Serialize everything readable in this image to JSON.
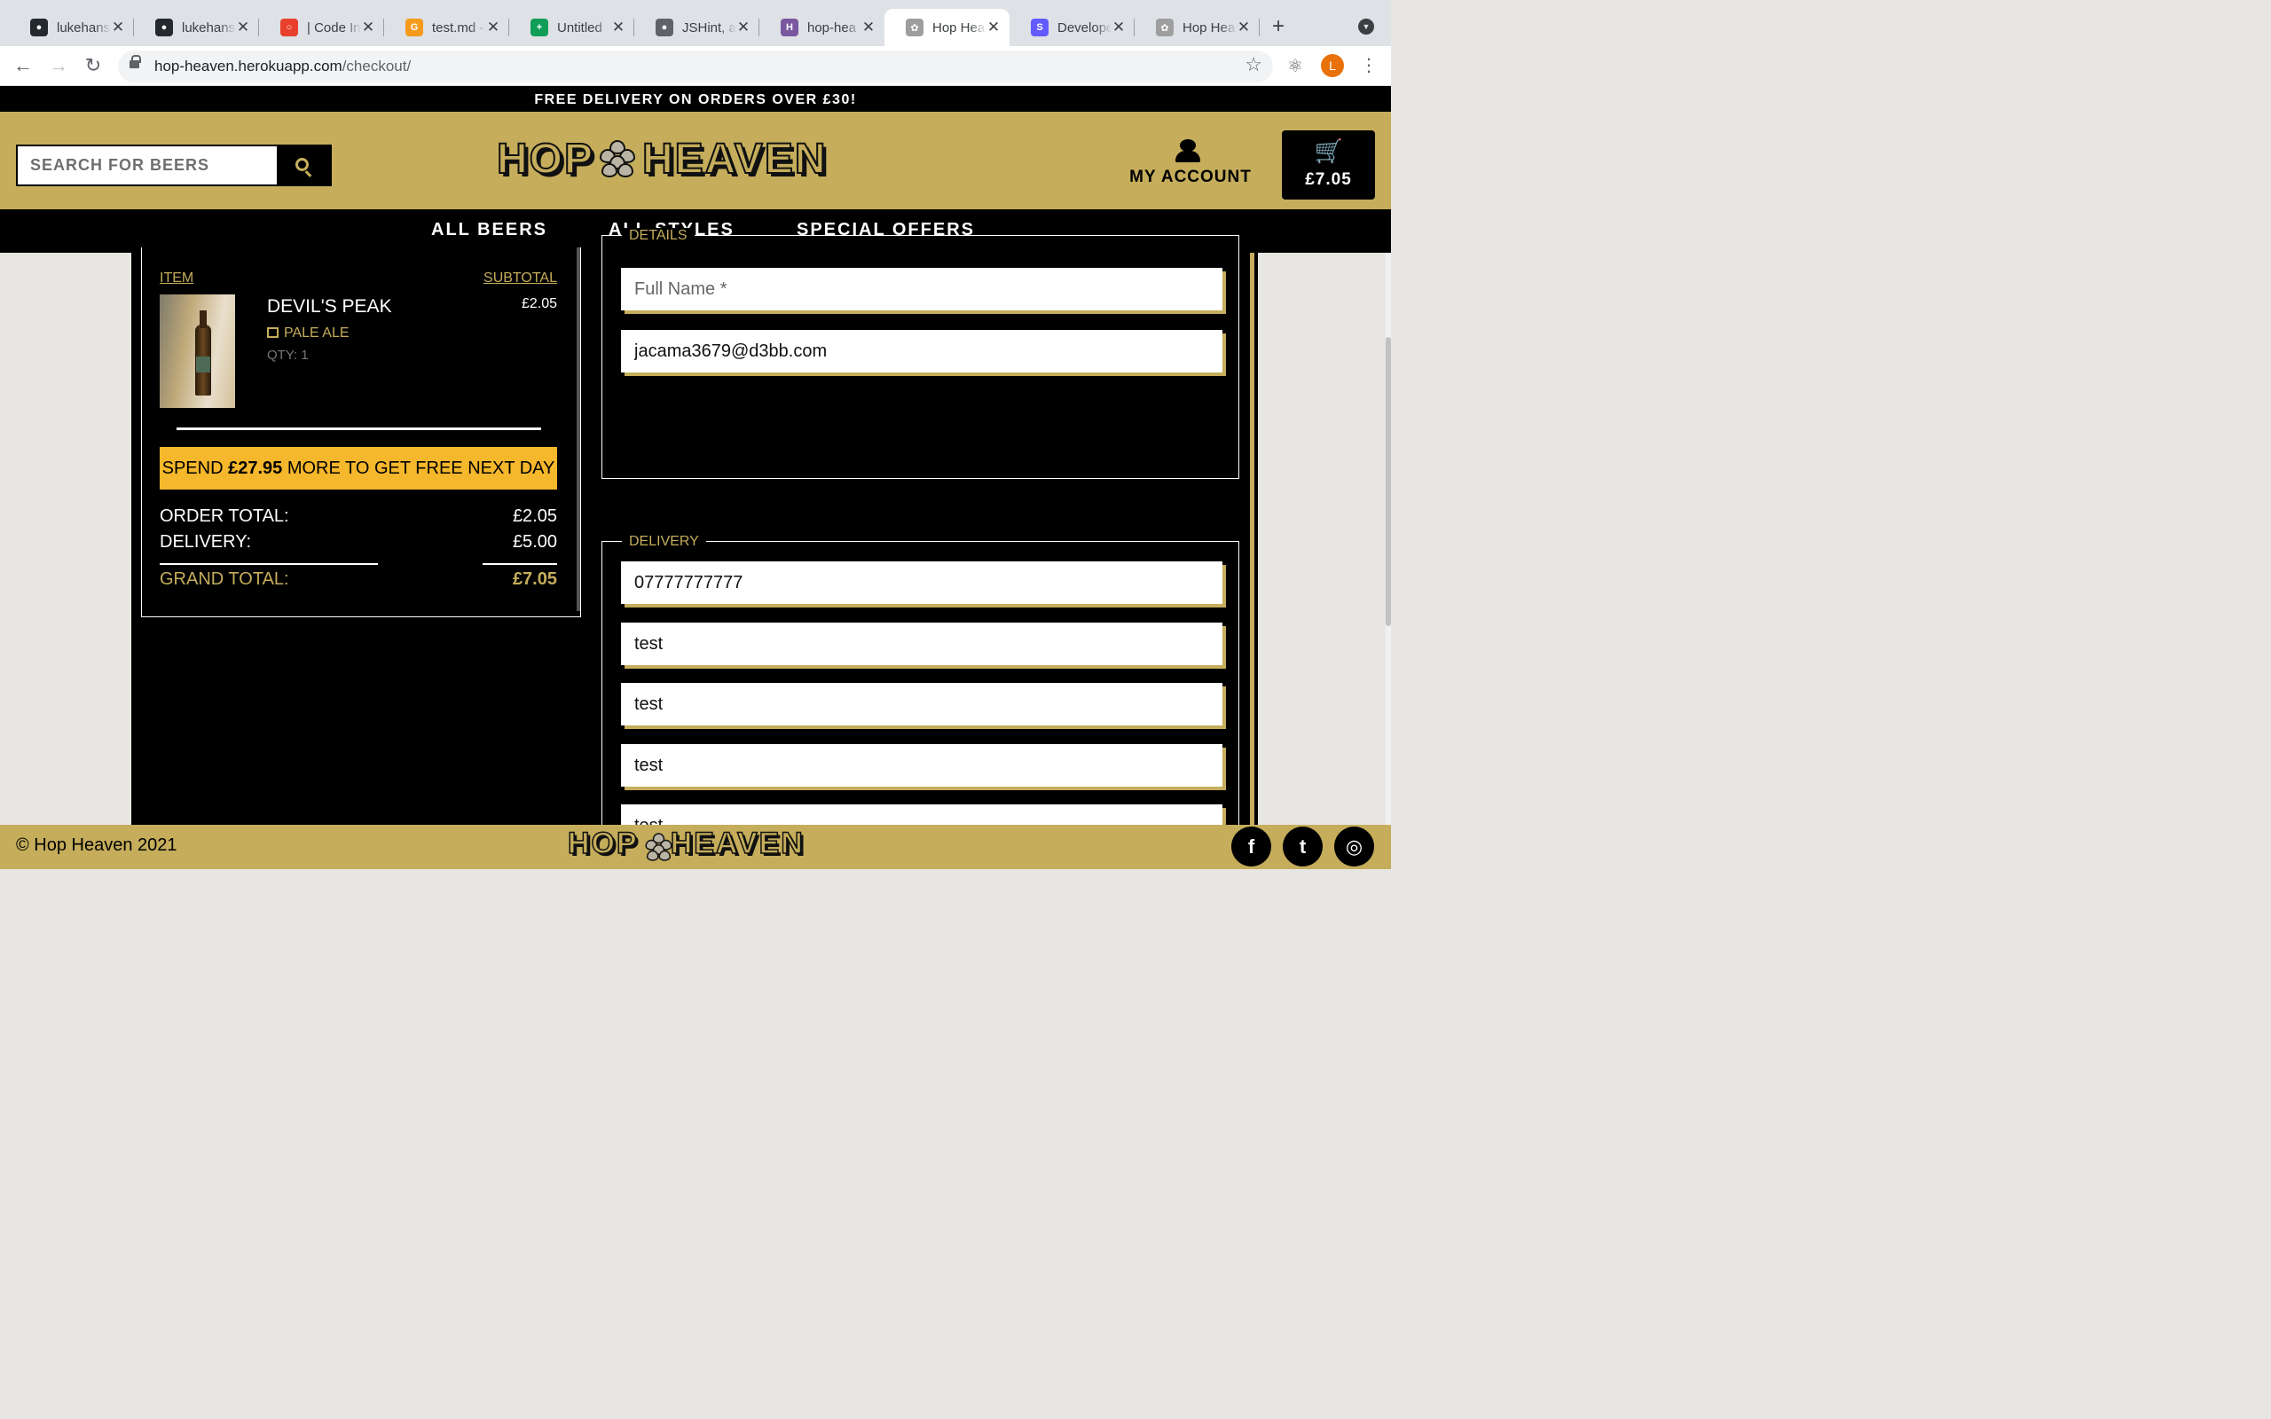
{
  "browser": {
    "tabs": [
      {
        "title": "lukehans",
        "favicon": "github-icon",
        "color": "#24292e",
        "glyph": "●"
      },
      {
        "title": "lukehans",
        "favicon": "github-icon",
        "color": "#24292e",
        "glyph": "●"
      },
      {
        "title": "| Code In",
        "favicon": "code-institute-icon",
        "color": "#e8402c",
        "glyph": "○"
      },
      {
        "title": "test.md -",
        "favicon": "gitpod-icon",
        "color": "#f49b1b",
        "glyph": "G"
      },
      {
        "title": "Untitled",
        "favicon": "google-sheets-icon",
        "color": "#0f9d58",
        "glyph": "+"
      },
      {
        "title": "JSHint, a",
        "favicon": "globe-icon",
        "color": "#5f6368",
        "glyph": "●"
      },
      {
        "title": "hop-hea",
        "favicon": "heroku-icon",
        "color": "#79589f",
        "glyph": "H"
      },
      {
        "title": "Hop Hea",
        "favicon": "hop-icon",
        "color": "#9e9e9e",
        "glyph": "✿",
        "active": true
      },
      {
        "title": "Develope",
        "favicon": "stripe-icon",
        "color": "#635bff",
        "glyph": "S"
      },
      {
        "title": "Hop Hea",
        "favicon": "hop-icon",
        "color": "#9e9e9e",
        "glyph": "✿"
      }
    ],
    "url_host": "hop-heaven.herokuapp.com",
    "url_path": "/checkout/",
    "profile_initial": "L"
  },
  "site": {
    "banner": "FREE DELIVERY ON ORDERS OVER £30!",
    "search_placeholder": "SEARCH FOR BEERS",
    "logo_left": "HOP",
    "logo_right": "HEAVEN",
    "account_label": "MY ACCOUNT",
    "cart_total": "£7.05",
    "nav": [
      "ALL BEERS",
      "ALL STYLES",
      "SPECIAL OFFERS"
    ]
  },
  "order": {
    "col_item": "ITEM",
    "col_subtotal": "SUBTOTAL",
    "item": {
      "name": "DEVIL'S PEAK",
      "style": "PALE ALE",
      "qty": "QTY: 1",
      "price": "£2.05"
    },
    "spend_prefix": "SPEND ",
    "spend_amount": "£27.95",
    "spend_suffix": " MORE TO GET FREE NEXT DAY DELIVERY!",
    "order_total_label": "ORDER TOTAL:",
    "order_total": "£2.05",
    "delivery_label": "DELIVERY:",
    "delivery": "£5.00",
    "grand_total_label": "GRAND TOTAL:",
    "grand_total": "£7.05"
  },
  "form": {
    "details_legend": "DETAILS",
    "full_name_placeholder": "Full Name *",
    "email_value": "jacama3679@d3bb.com",
    "delivery_legend": "DELIVERY",
    "phone_value": "07777777777",
    "address_values": [
      "test",
      "test",
      "test",
      "test",
      "test"
    ]
  },
  "footer": {
    "copyright": "© Hop Heaven 2021",
    "logo_left": "HOP",
    "logo_right": "HEAVEN",
    "social": [
      {
        "name": "facebook-icon",
        "glyph": "f"
      },
      {
        "name": "twitter-icon",
        "glyph": "t"
      },
      {
        "name": "instagram-icon",
        "glyph": "◎"
      }
    ]
  },
  "colors": {
    "brand_gold": "#c5ad5b",
    "notice_yellow": "#f5b72b",
    "black": "#000000"
  }
}
